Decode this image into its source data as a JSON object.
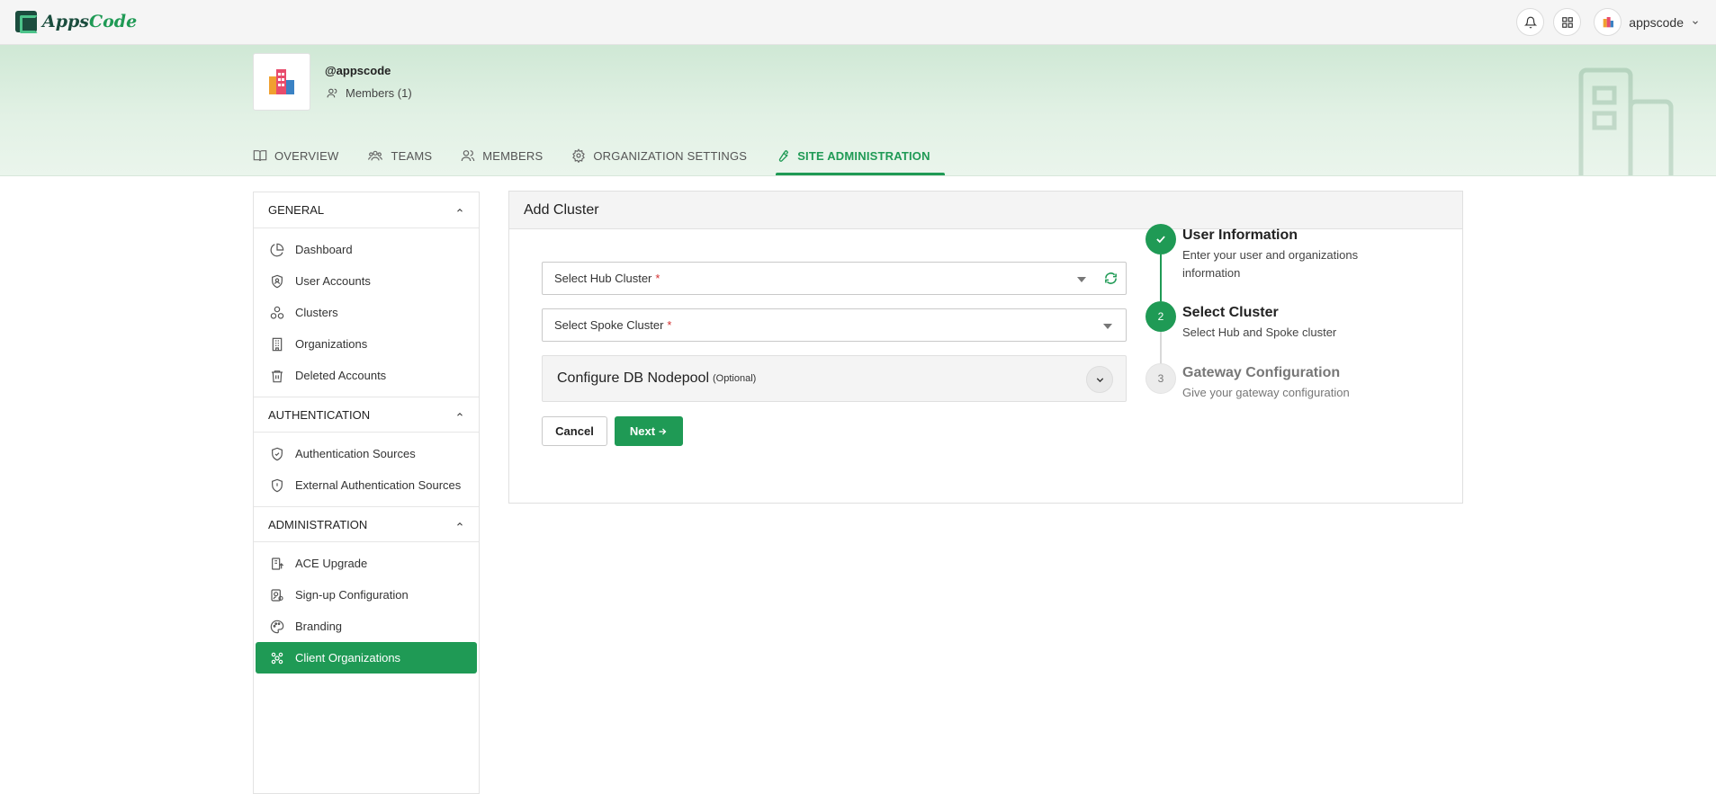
{
  "header": {
    "brand": {
      "prefix": "Apps",
      "suffix": "Code"
    },
    "username": "appscode"
  },
  "org": {
    "handle": "@appscode",
    "members": "Members (1)",
    "tabs": [
      {
        "label": "OVERVIEW"
      },
      {
        "label": "TEAMS"
      },
      {
        "label": "MEMBERS"
      },
      {
        "label": "ORGANIZATION SETTINGS"
      },
      {
        "label": "SITE ADMINISTRATION"
      }
    ]
  },
  "sidebar": {
    "groups": [
      {
        "title": "GENERAL",
        "items": [
          "Dashboard",
          "User Accounts",
          "Clusters",
          "Organizations",
          "Deleted Accounts"
        ]
      },
      {
        "title": "AUTHENTICATION",
        "items": [
          "Authentication Sources",
          "External Authentication Sources"
        ]
      },
      {
        "title": "ADMINISTRATION",
        "items": [
          "ACE Upgrade",
          "Sign-up Configuration",
          "Branding",
          "Client Organizations"
        ]
      }
    ]
  },
  "main": {
    "title": "Add Cluster",
    "hub_label": "Select Hub Cluster",
    "spoke_label": "Select Spoke Cluster",
    "required_mark": "*",
    "nodepool_title": "Configure DB Nodepool",
    "nodepool_optional": "(Optional)",
    "cancel_label": "Cancel",
    "next_label": "Next"
  },
  "steps": [
    {
      "title": "User Information",
      "desc": "Enter your user and organizations information",
      "state": "done"
    },
    {
      "number": "2",
      "title": "Select Cluster",
      "desc": "Select Hub and Spoke cluster",
      "state": "active"
    },
    {
      "number": "3",
      "title": "Gateway Configuration",
      "desc": "Give your gateway configuration",
      "state": "todo"
    }
  ],
  "colors": {
    "accent": "#1f9a55",
    "brand_dark": "#1b4d3e"
  }
}
